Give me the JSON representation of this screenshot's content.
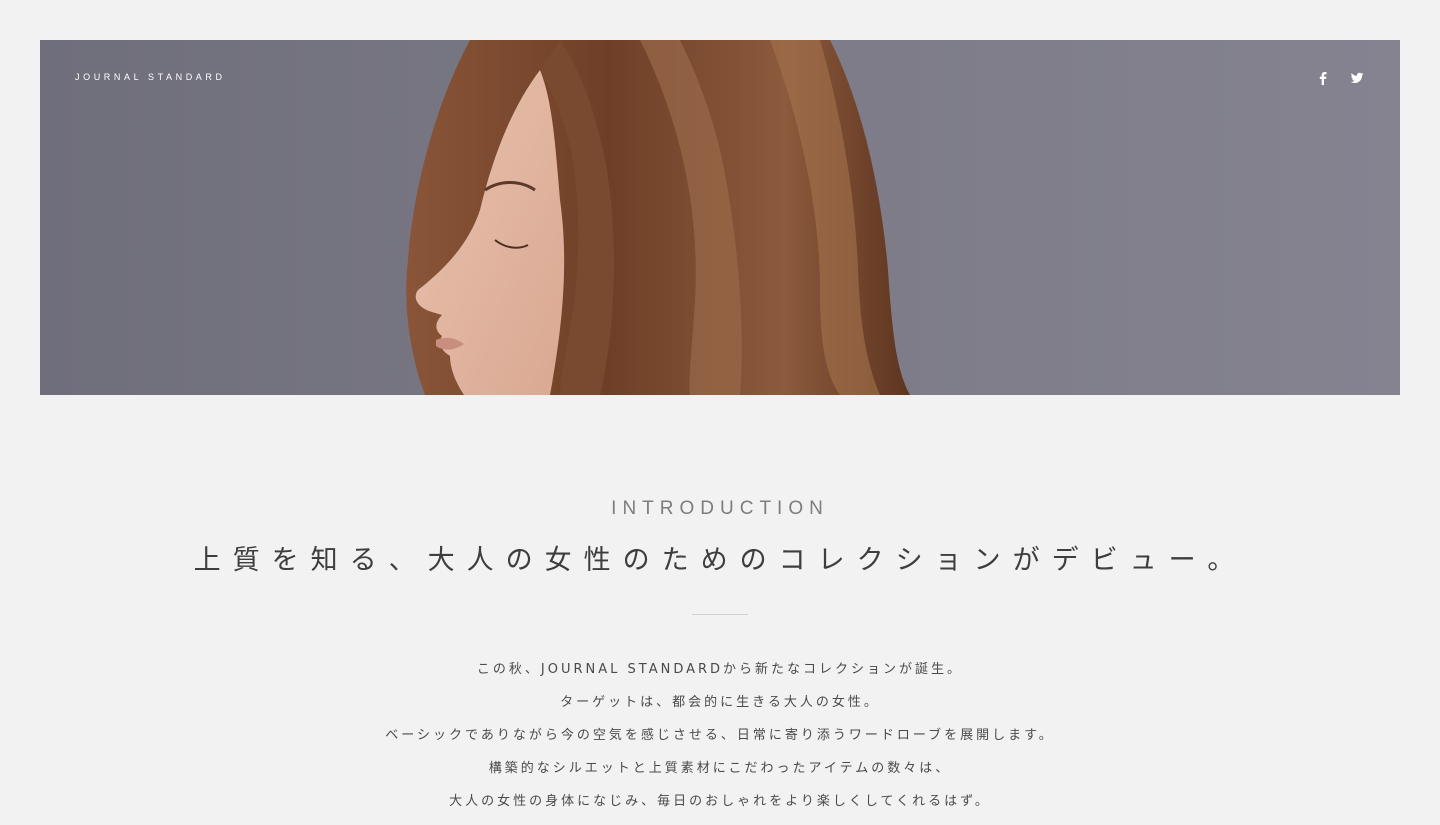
{
  "header": {
    "brand": "JOURNAL STANDARD",
    "social": [
      {
        "icon": "facebook-icon"
      },
      {
        "icon": "twitter-icon"
      }
    ]
  },
  "hero": {
    "background_color": "#76757f",
    "hair_color": "#7a4a30",
    "skin_color": "#e4b9a4"
  },
  "intro": {
    "label": "INTRODUCTION",
    "headline": "上質を知る、大人の女性のためのコレクションがデビュー。",
    "body": [
      "この秋、JOURNAL STANDARDから新たなコレクションが誕生。",
      "ターゲットは、都会的に生きる大人の女性。",
      "ベーシックでありながら今の空気を感じさせる、日常に寄り添うワードローブを展開します。",
      "構築的なシルエットと上質素材にこだわったアイテムの数々は、",
      "大人の女性の身体になじみ、毎日のおしゃれをより楽しくしてくれるはず。"
    ]
  }
}
